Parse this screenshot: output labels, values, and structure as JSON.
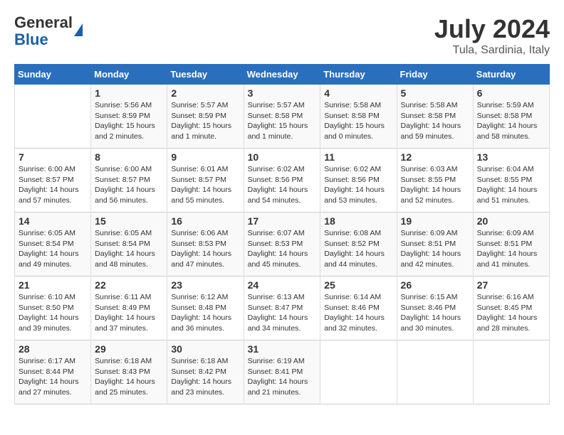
{
  "logo": {
    "general": "General",
    "blue": "Blue"
  },
  "header": {
    "month": "July 2024",
    "location": "Tula, Sardinia, Italy"
  },
  "days_of_week": [
    "Sunday",
    "Monday",
    "Tuesday",
    "Wednesday",
    "Thursday",
    "Friday",
    "Saturday"
  ],
  "weeks": [
    [
      {
        "day": "",
        "sunrise": "",
        "sunset": "",
        "daylight": ""
      },
      {
        "day": "1",
        "sunrise": "Sunrise: 5:56 AM",
        "sunset": "Sunset: 8:59 PM",
        "daylight": "Daylight: 15 hours and 2 minutes."
      },
      {
        "day": "2",
        "sunrise": "Sunrise: 5:57 AM",
        "sunset": "Sunset: 8:59 PM",
        "daylight": "Daylight: 15 hours and 1 minute."
      },
      {
        "day": "3",
        "sunrise": "Sunrise: 5:57 AM",
        "sunset": "Sunset: 8:58 PM",
        "daylight": "Daylight: 15 hours and 1 minute."
      },
      {
        "day": "4",
        "sunrise": "Sunrise: 5:58 AM",
        "sunset": "Sunset: 8:58 PM",
        "daylight": "Daylight: 15 hours and 0 minutes."
      },
      {
        "day": "5",
        "sunrise": "Sunrise: 5:58 AM",
        "sunset": "Sunset: 8:58 PM",
        "daylight": "Daylight: 14 hours and 59 minutes."
      },
      {
        "day": "6",
        "sunrise": "Sunrise: 5:59 AM",
        "sunset": "Sunset: 8:58 PM",
        "daylight": "Daylight: 14 hours and 58 minutes."
      }
    ],
    [
      {
        "day": "7",
        "sunrise": "Sunrise: 6:00 AM",
        "sunset": "Sunset: 8:57 PM",
        "daylight": "Daylight: 14 hours and 57 minutes."
      },
      {
        "day": "8",
        "sunrise": "Sunrise: 6:00 AM",
        "sunset": "Sunset: 8:57 PM",
        "daylight": "Daylight: 14 hours and 56 minutes."
      },
      {
        "day": "9",
        "sunrise": "Sunrise: 6:01 AM",
        "sunset": "Sunset: 8:57 PM",
        "daylight": "Daylight: 14 hours and 55 minutes."
      },
      {
        "day": "10",
        "sunrise": "Sunrise: 6:02 AM",
        "sunset": "Sunset: 8:56 PM",
        "daylight": "Daylight: 14 hours and 54 minutes."
      },
      {
        "day": "11",
        "sunrise": "Sunrise: 6:02 AM",
        "sunset": "Sunset: 8:56 PM",
        "daylight": "Daylight: 14 hours and 53 minutes."
      },
      {
        "day": "12",
        "sunrise": "Sunrise: 6:03 AM",
        "sunset": "Sunset: 8:55 PM",
        "daylight": "Daylight: 14 hours and 52 minutes."
      },
      {
        "day": "13",
        "sunrise": "Sunrise: 6:04 AM",
        "sunset": "Sunset: 8:55 PM",
        "daylight": "Daylight: 14 hours and 51 minutes."
      }
    ],
    [
      {
        "day": "14",
        "sunrise": "Sunrise: 6:05 AM",
        "sunset": "Sunset: 8:54 PM",
        "daylight": "Daylight: 14 hours and 49 minutes."
      },
      {
        "day": "15",
        "sunrise": "Sunrise: 6:05 AM",
        "sunset": "Sunset: 8:54 PM",
        "daylight": "Daylight: 14 hours and 48 minutes."
      },
      {
        "day": "16",
        "sunrise": "Sunrise: 6:06 AM",
        "sunset": "Sunset: 8:53 PM",
        "daylight": "Daylight: 14 hours and 47 minutes."
      },
      {
        "day": "17",
        "sunrise": "Sunrise: 6:07 AM",
        "sunset": "Sunset: 8:53 PM",
        "daylight": "Daylight: 14 hours and 45 minutes."
      },
      {
        "day": "18",
        "sunrise": "Sunrise: 6:08 AM",
        "sunset": "Sunset: 8:52 PM",
        "daylight": "Daylight: 14 hours and 44 minutes."
      },
      {
        "day": "19",
        "sunrise": "Sunrise: 6:09 AM",
        "sunset": "Sunset: 8:51 PM",
        "daylight": "Daylight: 14 hours and 42 minutes."
      },
      {
        "day": "20",
        "sunrise": "Sunrise: 6:09 AM",
        "sunset": "Sunset: 8:51 PM",
        "daylight": "Daylight: 14 hours and 41 minutes."
      }
    ],
    [
      {
        "day": "21",
        "sunrise": "Sunrise: 6:10 AM",
        "sunset": "Sunset: 8:50 PM",
        "daylight": "Daylight: 14 hours and 39 minutes."
      },
      {
        "day": "22",
        "sunrise": "Sunrise: 6:11 AM",
        "sunset": "Sunset: 8:49 PM",
        "daylight": "Daylight: 14 hours and 37 minutes."
      },
      {
        "day": "23",
        "sunrise": "Sunrise: 6:12 AM",
        "sunset": "Sunset: 8:48 PM",
        "daylight": "Daylight: 14 hours and 36 minutes."
      },
      {
        "day": "24",
        "sunrise": "Sunrise: 6:13 AM",
        "sunset": "Sunset: 8:47 PM",
        "daylight": "Daylight: 14 hours and 34 minutes."
      },
      {
        "day": "25",
        "sunrise": "Sunrise: 6:14 AM",
        "sunset": "Sunset: 8:46 PM",
        "daylight": "Daylight: 14 hours and 32 minutes."
      },
      {
        "day": "26",
        "sunrise": "Sunrise: 6:15 AM",
        "sunset": "Sunset: 8:46 PM",
        "daylight": "Daylight: 14 hours and 30 minutes."
      },
      {
        "day": "27",
        "sunrise": "Sunrise: 6:16 AM",
        "sunset": "Sunset: 8:45 PM",
        "daylight": "Daylight: 14 hours and 28 minutes."
      }
    ],
    [
      {
        "day": "28",
        "sunrise": "Sunrise: 6:17 AM",
        "sunset": "Sunset: 8:44 PM",
        "daylight": "Daylight: 14 hours and 27 minutes."
      },
      {
        "day": "29",
        "sunrise": "Sunrise: 6:18 AM",
        "sunset": "Sunset: 8:43 PM",
        "daylight": "Daylight: 14 hours and 25 minutes."
      },
      {
        "day": "30",
        "sunrise": "Sunrise: 6:18 AM",
        "sunset": "Sunset: 8:42 PM",
        "daylight": "Daylight: 14 hours and 23 minutes."
      },
      {
        "day": "31",
        "sunrise": "Sunrise: 6:19 AM",
        "sunset": "Sunset: 8:41 PM",
        "daylight": "Daylight: 14 hours and 21 minutes."
      },
      {
        "day": "",
        "sunrise": "",
        "sunset": "",
        "daylight": ""
      },
      {
        "day": "",
        "sunrise": "",
        "sunset": "",
        "daylight": ""
      },
      {
        "day": "",
        "sunrise": "",
        "sunset": "",
        "daylight": ""
      }
    ]
  ]
}
